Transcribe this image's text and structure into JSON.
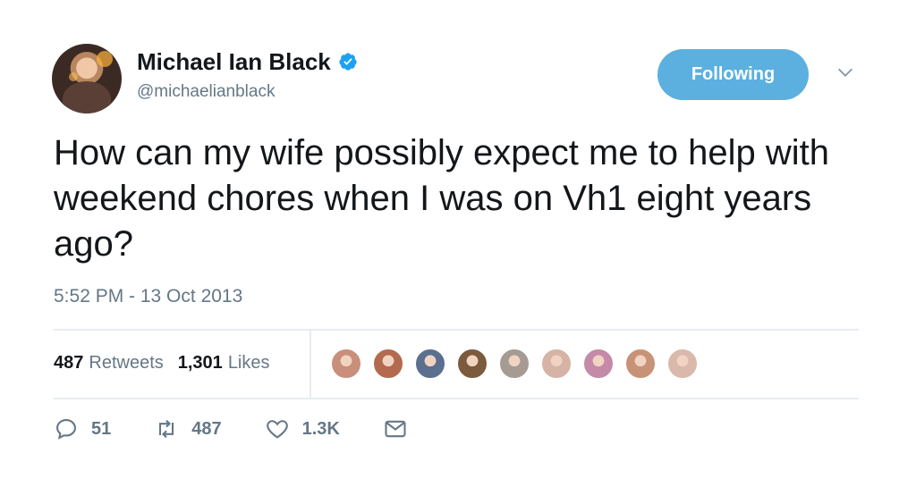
{
  "user": {
    "display_name": "Michael Ian Black",
    "handle": "@michaelianblack",
    "follow_button": "Following"
  },
  "tweet": {
    "text": "How can my wife possibly expect me to help with weekend chores when I was on Vh1 eight years ago?",
    "timestamp": "5:52 PM - 13 Oct 2013"
  },
  "stats": {
    "retweets_count": "487",
    "retweets_label": "Retweets",
    "likes_count": "1,301",
    "likes_label": "Likes"
  },
  "likers": {
    "count": 9,
    "colors": [
      "#c98f7a",
      "#b36a4f",
      "#5b6f8e",
      "#7b5a3d",
      "#a59b92",
      "#d5b3a5",
      "#c48aa8",
      "#c79277",
      "#d9b9aa"
    ]
  },
  "actions": {
    "reply_count": "51",
    "retweet_count": "487",
    "like_count": "1.3K"
  },
  "colors": {
    "accent": "#5bb0df",
    "verified": "#1da1f2",
    "muted": "#657786"
  },
  "icons": {
    "verified": "verified-badge-icon",
    "caret": "chevron-down-icon",
    "reply": "reply-icon",
    "retweet": "retweet-icon",
    "like": "heart-icon",
    "dm": "envelope-icon"
  }
}
